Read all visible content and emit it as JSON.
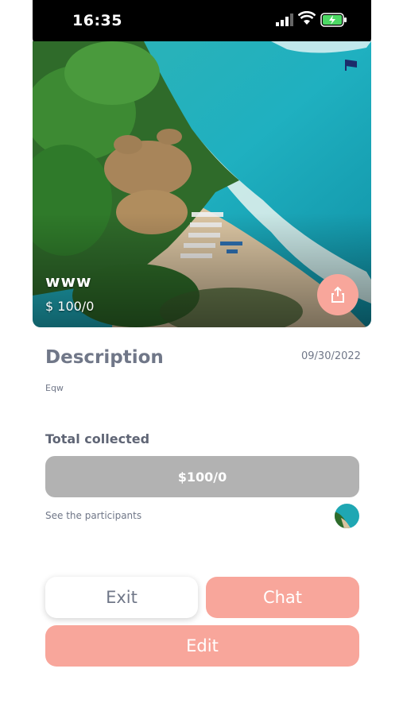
{
  "status_bar": {
    "time": "16:35"
  },
  "hero": {
    "title": "www",
    "amount": "$ 100/0"
  },
  "details": {
    "description_title": "Description",
    "date": "09/30/2022",
    "description_text": "Eqw",
    "total_label": "Total collected",
    "total_value": "$100/0",
    "participants_link": "See the participants"
  },
  "actions": {
    "exit_label": "Exit",
    "chat_label": "Chat",
    "edit_label": "Edit"
  },
  "colors": {
    "accent": "#f8a69b",
    "text": "#707788",
    "total_bar": "#b2b2b2"
  }
}
